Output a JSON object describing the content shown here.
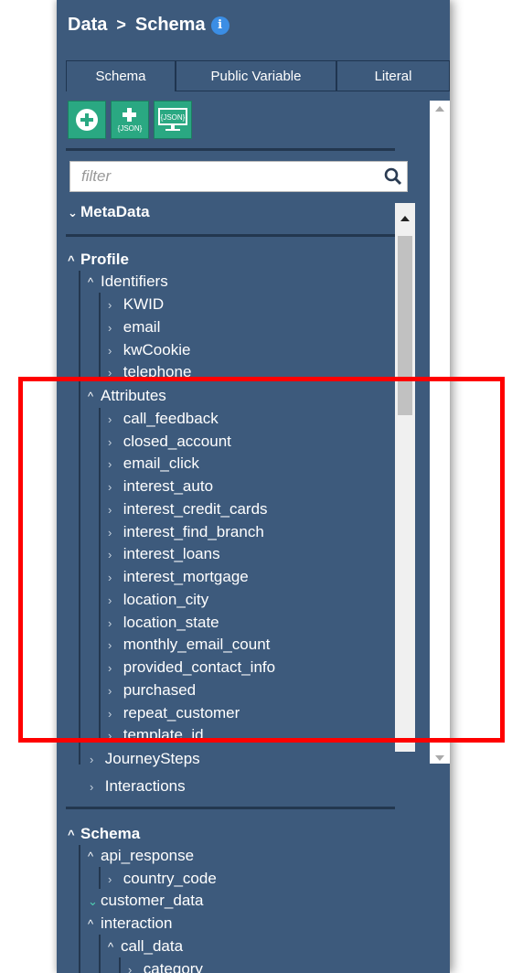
{
  "breadcrumb": {
    "part1": "Data",
    "separator": ">",
    "part2": "Schema",
    "info": "i"
  },
  "tabs": [
    "Schema",
    "Public Variable",
    "Literal"
  ],
  "toolbar": {
    "add": "add-circle-icon",
    "add_json": "add-json-icon",
    "view_json": "json-monitor-icon",
    "json_label": "{JSON}"
  },
  "filter": {
    "placeholder": "filter",
    "value": ""
  },
  "tree": {
    "metadata": "MetaData",
    "profile": "Profile",
    "identifiers": "Identifiers",
    "identifier_items": [
      "KWID",
      "email",
      "kwCookie",
      "telephone"
    ],
    "attributes": "Attributes",
    "attribute_items": [
      "call_feedback",
      "closed_account",
      "email_click",
      "interest_auto",
      "interest_credit_cards",
      "interest_find_branch",
      "interest_loans",
      "interest_mortgage",
      "location_city",
      "location_state",
      "monthly_email_count",
      "provided_contact_info",
      "purchased",
      "repeat_customer",
      "template_id"
    ],
    "journey_steps": "JourneySteps",
    "interactions": "Interactions",
    "schema": "Schema",
    "api_response": "api_response",
    "country_code": "country_code",
    "customer_data": "customer_data",
    "interaction": "interaction",
    "call_data": "call_data",
    "category": "category"
  },
  "colors": {
    "panel": "#3d5a7c",
    "accent_green": "#2aa882",
    "info_blue": "#3b8ee5",
    "highlight": "#ff0000",
    "expanded_teal": "#4fd1b3"
  }
}
